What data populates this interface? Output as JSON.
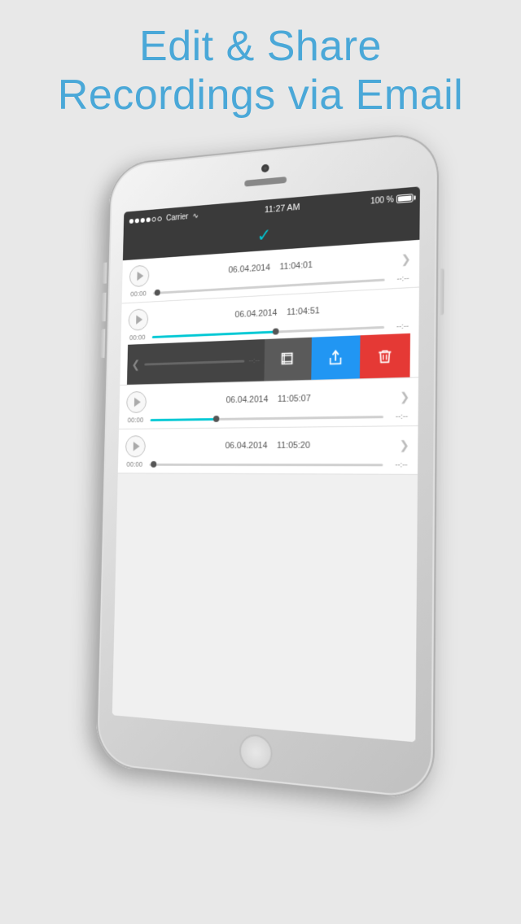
{
  "header": {
    "line1": "Edit & Share",
    "line2": "Recordings via Email"
  },
  "phone": {
    "statusBar": {
      "carrier": "Carrier",
      "time": "11:27 AM",
      "battery": "100 %"
    },
    "appHeader": {
      "checkIcon": "✓"
    },
    "recordings": [
      {
        "id": 1,
        "date": "06.04.2014",
        "time": "11:04:01",
        "scrubberTime": "00:00",
        "scrubberEnd": "--:--",
        "fillPercent": "0%",
        "thumbPos": "0%",
        "expanded": false
      },
      {
        "id": 2,
        "date": "06.04.2014",
        "time": "11:04:51",
        "scrubberTime": "00:00",
        "scrubberEnd": "--:--",
        "fillPercent": "55%",
        "thumbPos": "55%",
        "expanded": true,
        "actions": {
          "editLabel": "edit",
          "shareLabel": "share",
          "deleteLabel": "delete"
        }
      },
      {
        "id": 3,
        "date": "06.04.2014",
        "time": "11:05:07",
        "scrubberTime": "00:00",
        "scrubberEnd": "--:--",
        "fillPercent": "30%",
        "thumbPos": "30%",
        "expanded": false
      },
      {
        "id": 4,
        "date": "06.04.2014",
        "time": "11:05:20",
        "scrubberTime": "00:00",
        "scrubberEnd": "--:--",
        "fillPercent": "0%",
        "thumbPos": "0%",
        "expanded": false
      }
    ]
  },
  "icons": {
    "play": "▶",
    "chevronRight": "❯",
    "chevronLeft": "❮",
    "check": "✔"
  }
}
